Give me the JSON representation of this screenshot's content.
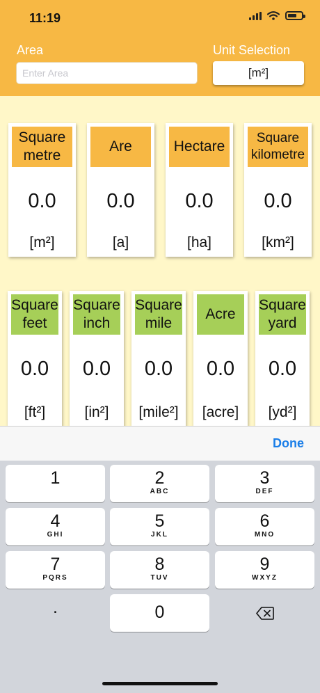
{
  "status": {
    "time": "11:19"
  },
  "header": {
    "area_label": "Area",
    "area_placeholder": "Enter Area",
    "unit_label": "Unit Selection",
    "unit_value": "[m²]"
  },
  "metric_cards": [
    {
      "title": "Square metre",
      "value": "0.0",
      "unit": "[m²]"
    },
    {
      "title": "Are",
      "value": "0.0",
      "unit": "[a]"
    },
    {
      "title": "Hectare",
      "value": "0.0",
      "unit": "[ha]"
    },
    {
      "title": "Square kilometre",
      "value": "0.0",
      "unit": "[km²]"
    }
  ],
  "imperial_cards": [
    {
      "title": "Square feet",
      "value": "0.0",
      "unit": "[ft²]"
    },
    {
      "title": "Square inch",
      "value": "0.0",
      "unit": "[in²]"
    },
    {
      "title": "Square mile",
      "value": "0.0",
      "unit": "[mile²]"
    },
    {
      "title": "Acre",
      "value": "0.0",
      "unit": "[acre]"
    },
    {
      "title": "Square yard",
      "value": "0.0",
      "unit": "[yd²]"
    }
  ],
  "toolbar": {
    "done_label": "Done"
  },
  "keypad": {
    "keys": [
      {
        "num": "1",
        "letters": ""
      },
      {
        "num": "2",
        "letters": "ABC"
      },
      {
        "num": "3",
        "letters": "DEF"
      },
      {
        "num": "4",
        "letters": "GHI"
      },
      {
        "num": "5",
        "letters": "JKL"
      },
      {
        "num": "6",
        "letters": "MNO"
      },
      {
        "num": "7",
        "letters": "PQRS"
      },
      {
        "num": "8",
        "letters": "TUV"
      },
      {
        "num": "9",
        "letters": "WXYZ"
      },
      {
        "num": "0",
        "letters": ""
      }
    ],
    "decimal_label": "."
  },
  "colors": {
    "header": "#f7b844",
    "metric_title": "#f7b844",
    "imperial_title": "#a6cf58",
    "background": "#fff7c8",
    "done": "#1a7ee8"
  }
}
